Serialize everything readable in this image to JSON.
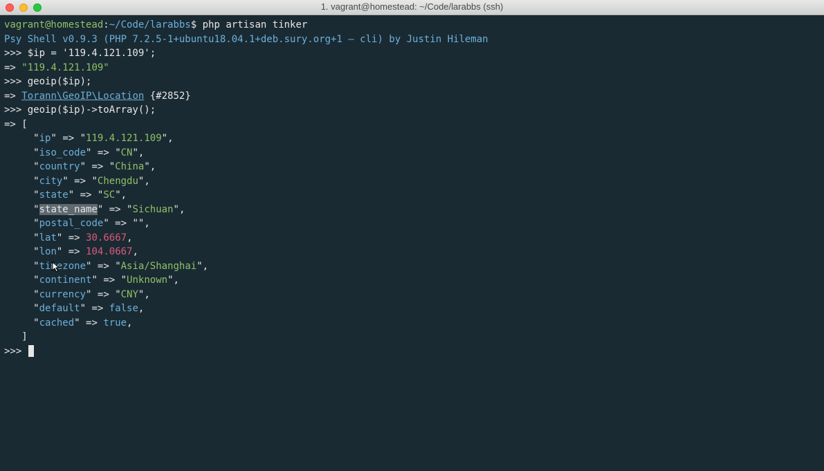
{
  "window": {
    "title": "1. vagrant@homestead: ~/Code/larabbs (ssh)"
  },
  "prompt": {
    "user": "vagrant@homestead",
    "sep": ":",
    "path": "~/Code/larabbs",
    "dollar": "$",
    "command": "php artisan tinker"
  },
  "psy_banner": "Psy Shell v0.9.3 (PHP 7.2.5-1+ubuntu18.04.1+deb.sury.org+1 — cli) by Justin Hileman",
  "repl": {
    "prompt_in": ">>> ",
    "prompt_out": "=> ",
    "l1_in": "$ip = '119.4.121.109';",
    "l1_out_str": "\"119.4.121.109\"",
    "l2_in": "geoip($ip);",
    "l2_class": "Torann\\GeoIP\\Location",
    "l2_hash": " {#2852}",
    "l3_in": "geoip($ip)->toArray();",
    "array_open": "[",
    "array_close": "   ]",
    "indent": "     ",
    "arrow": " => ",
    "comma": ",",
    "q": "\"",
    "keys": {
      "ip": "ip",
      "iso_code": "iso_code",
      "country": "country",
      "city": "city",
      "state": "state",
      "state_name": "state_name",
      "postal_code": "postal_code",
      "lat": "lat",
      "lon": "lon",
      "timezone": "timezone",
      "continent": "continent",
      "currency": "currency",
      "default": "default",
      "cached": "cached"
    },
    "vals": {
      "ip": "119.4.121.109",
      "iso_code": "CN",
      "country": "China",
      "city": "Chengdu",
      "state": "SC",
      "state_name": "Sichuan",
      "postal_code": "",
      "lat": "30.6667",
      "lon": "104.0667",
      "timezone": "Asia/Shanghai",
      "continent": "Unknown",
      "currency": "CNY",
      "default": "false",
      "cached": "true"
    }
  }
}
